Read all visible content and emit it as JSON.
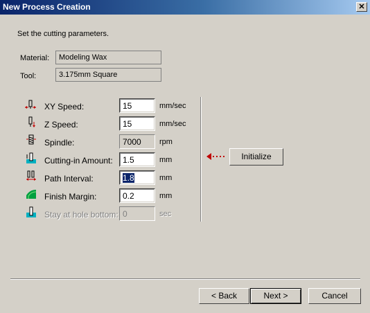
{
  "window": {
    "title": "New Process Creation",
    "close_glyph": "✕"
  },
  "instruction": "Set the cutting parameters.",
  "material": {
    "label": "Material:",
    "value": "Modeling Wax"
  },
  "tool": {
    "label": "Tool:",
    "value": "3.175mm Square"
  },
  "params": [
    {
      "label": "XY Speed:",
      "value": "15",
      "unit": "mm/sec",
      "icon": "xy-speed-icon"
    },
    {
      "label": "Z Speed:",
      "value": "15",
      "unit": "mm/sec",
      "icon": "z-speed-icon"
    },
    {
      "label": "Spindle:",
      "value": "7000",
      "unit": "rpm",
      "icon": "spindle-icon"
    },
    {
      "label": "Cutting-in Amount:",
      "value": "1.5",
      "unit": "mm",
      "icon": "cutting-in-icon"
    },
    {
      "label": "Path Interval:",
      "value": "1.8",
      "unit": "mm",
      "icon": "path-interval-icon"
    },
    {
      "label": "Finish Margin:",
      "value": "0.2",
      "unit": "mm",
      "icon": "finish-margin-icon"
    },
    {
      "label": "Stay at hole bottom:",
      "value": "0",
      "unit": "sec",
      "icon": "stay-hole-icon"
    }
  ],
  "initialize_button": "Initialize",
  "footer": {
    "back": "< Back",
    "next": "Next >",
    "cancel": "Cancel"
  }
}
